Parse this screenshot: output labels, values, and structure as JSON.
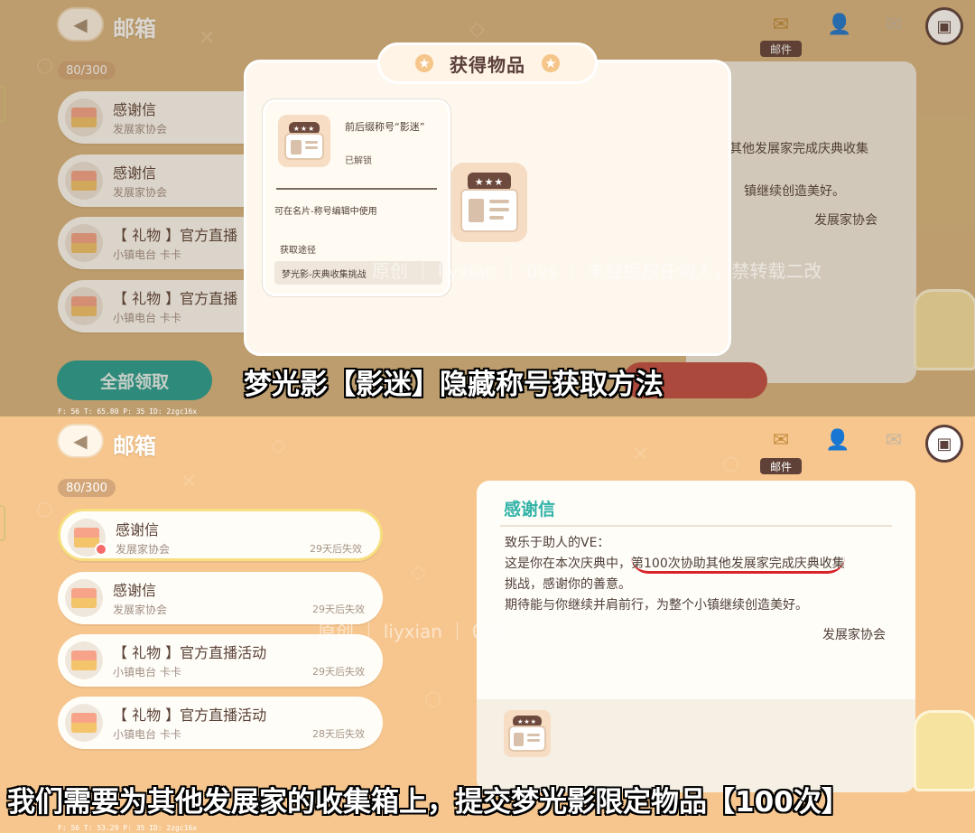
{
  "header": {
    "title": "邮箱",
    "counter": "80/300",
    "mail_tab_label": "邮件"
  },
  "mails": [
    {
      "title": "感谢信",
      "sender": "发展家协会",
      "expire": "29天后失效"
    },
    {
      "title": "感谢信",
      "sender": "发展家协会",
      "expire": "29天后失效"
    },
    {
      "title": "【 礼物 】官方直播活动",
      "sender": "小镇电台 卡卡",
      "expire": "29天后失效"
    },
    {
      "title": "【 礼物 】官方直播活动",
      "sender": "小镇电台 卡卡",
      "expire": "28天后失效"
    }
  ],
  "top_mails": [
    {
      "title": "感谢信",
      "sender": "发展家协会"
    },
    {
      "title": "感谢信",
      "sender": "发展家协会"
    },
    {
      "title": "【 礼物 】官方直播",
      "sender": "小镇电台 卡卡"
    },
    {
      "title": "【 礼物 】官方直播",
      "sender": "小镇电台 卡卡"
    }
  ],
  "collect_all": "全部领取",
  "popup": {
    "title": "获得物品",
    "item_name": "前后缀称号“影迷”",
    "item_status": "已解锁",
    "item_desc": "可在名片-称号编辑中使用",
    "source_label": "获取途径",
    "source": "梦光影-庆典收集挑战",
    "stars": "★★★"
  },
  "detail_top": {
    "line1": "其他发展家完成庆典收集",
    "line2": "镇继续创造美好。",
    "sign": "发展家协会"
  },
  "detail": {
    "title": "感谢信",
    "greeting": "致乐于助人的VE：",
    "line1_a": "这是你在本次庆典中，",
    "line1_b": "第100次协助其他发展家完成庆典收集",
    "line2": "挑战，感谢你的善意。",
    "line3": "期待能与你继续并肩前行，为整个小镇继续创造美好。",
    "sign": "发展家协会"
  },
  "captions": {
    "top": "梦光影【影迷】隐藏称号获取方法",
    "bottom": "我们需要为其他发展家的收集箱上，提交梦光影限定物品【100次】"
  },
  "watermarks": {
    "top": "原创 ｜ liyxian ｜ 0vs ｜ 未经授权任何人，禁转载二改",
    "bottom": "原创 ｜ liyxian ｜ 0vs"
  },
  "debug": {
    "top": "F: 56   T: 65.80   P: 35   ID: 2zgc16x",
    "bottom": "F: 56   T: 53.29   P: 35   ID: 2zgc16x"
  },
  "colors": {
    "accent": "#32b3a7",
    "collect_button": "#229e93",
    "underline": "#d8232a"
  },
  "icons": [
    "back-arrow-icon",
    "mail-icon",
    "add-friend-icon",
    "starred-mail-icon",
    "profile-card-icon",
    "envelope-icon",
    "name-badge-icon"
  ]
}
